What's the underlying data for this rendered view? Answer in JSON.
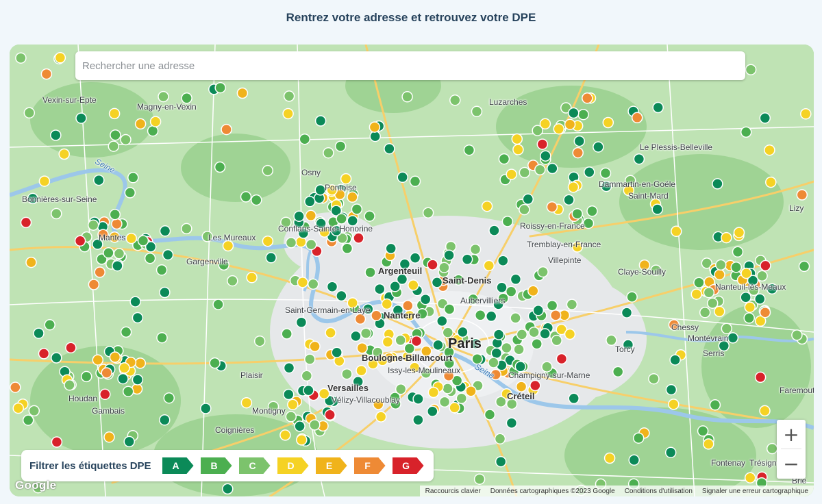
{
  "header": {
    "title": "Rentrez votre adresse et retrouvez votre DPE"
  },
  "search": {
    "placeholder": "Rechercher une adresse",
    "value": ""
  },
  "filter": {
    "label": "Filtrer les étiquettes DPE",
    "tags": [
      {
        "letter": "A",
        "color": "#0b8a58"
      },
      {
        "letter": "B",
        "color": "#4caf50"
      },
      {
        "letter": "C",
        "color": "#7cc36c"
      },
      {
        "letter": "D",
        "color": "#f5d224"
      },
      {
        "letter": "E",
        "color": "#f0b31b"
      },
      {
        "letter": "F",
        "color": "#ee8a35"
      },
      {
        "letter": "G",
        "color": "#d8222a"
      }
    ]
  },
  "zoom": {
    "in_label": "+",
    "out_label": "−"
  },
  "brand": {
    "logo": "Google"
  },
  "attribution": {
    "shortcuts": "Raccourcis clavier",
    "data": "Données cartographiques ©2023 Google",
    "terms": "Conditions d'utilisation",
    "report": "Signaler une erreur cartographique"
  },
  "places": {
    "paris": "Paris",
    "vexin": "Vexin-sur-Epte",
    "magny": "Magny-en-Vexin",
    "bonnieres": "Bonnières-sur-Seine",
    "mantes": "Mantes",
    "gargenville": "Gargenville",
    "meulan": "Les Mureaux",
    "conflans": "Conflans-Sainte-Honorine",
    "cergy": "Osny",
    "pontoise": "Pontoise",
    "luzarches": "Luzarches",
    "plessis": "Le Plessis-Belleville",
    "dammartin": "Dammartin-en-Goële",
    "saint_mard": "Saint-Mard",
    "lizy": "Lizy",
    "roissy": "Roissy-en-France",
    "tremblay": "Tremblay-en-France",
    "villepinte": "Villepinte",
    "claye": "Claye-Souilly",
    "meaux": "Nanteuil-lès-Meaux",
    "saint_denis": "Saint-Denis",
    "argenteuil": "Argenteuil",
    "aubervilliers": "Aubervilliers",
    "saint_germain": "Saint-Germain-en-Laye",
    "nanterre": "Nanterre",
    "boulogne": "Boulogne-Billancourt",
    "issy": "Issy-les-Moulineaux",
    "versailles": "Versailles",
    "velizy": "Vélizy-Villacoublay",
    "plaisir": "Plaisir",
    "montigny": "Montigny",
    "coignieres": "Coignières",
    "gambais": "Gambais",
    "houdan": "Houdan",
    "champigny": "Champigny-sur-Marne",
    "creteil": "Créteil",
    "torcy": "Torcy",
    "chessy": "Chessy",
    "montevrain": "Montévrain",
    "serris": "Serris",
    "faremoutiers": "Faremoutiers",
    "fontenay": "Fontenay",
    "tresigny": "Trésigny",
    "brie": "Brie",
    "seine_label": "Seine",
    "seine_label_2": "Seine"
  }
}
